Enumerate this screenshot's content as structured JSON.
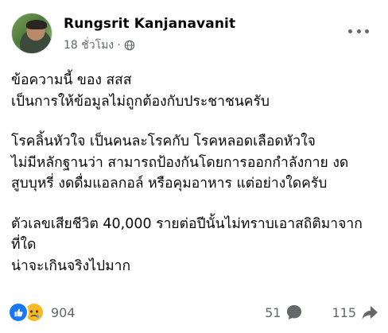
{
  "post": {
    "author": "Rungsrit Kanjanavanit",
    "time": "18 ชั่วโมง",
    "separator": "·",
    "privacy_icon": "globe-icon",
    "more_icon": "more-options-icon",
    "paragraphs": [
      "ข้อความนี้ ของ สสส",
      "เป็นการให้ข้อมูลไม่ถูกต้องกับประชาชนครับ",
      "",
      "โรคลิ้นหัวใจ เป็นคนละโรคกับ โรคหลอดเลือดหัวใจ",
      "ไม่มีหลักฐานว่า สามารถป้องกันโดยการออกกำลังกาย งด",
      "สูบบุหรี่ งดดื่มแอลกอล์ หรือคุมอาหาร แต่อย่างใดครับ",
      "",
      "ตัวเลขเสียชีวิต 40,000 รายต่อปีนั้นไม่ทราบเอาสถิติมาจาก",
      "ที่ใด",
      "น่าจะเกินจริงไปมาก￼"
    ]
  },
  "footer": {
    "reaction_icons": [
      "like-icon",
      "sad-icon"
    ],
    "reaction_count": "904",
    "comment_count": "51",
    "share_count": "115"
  },
  "colors": {
    "secondary_text": "#65676b",
    "like_blue": "#1877f2",
    "sad_yellow": "#f7b928"
  }
}
